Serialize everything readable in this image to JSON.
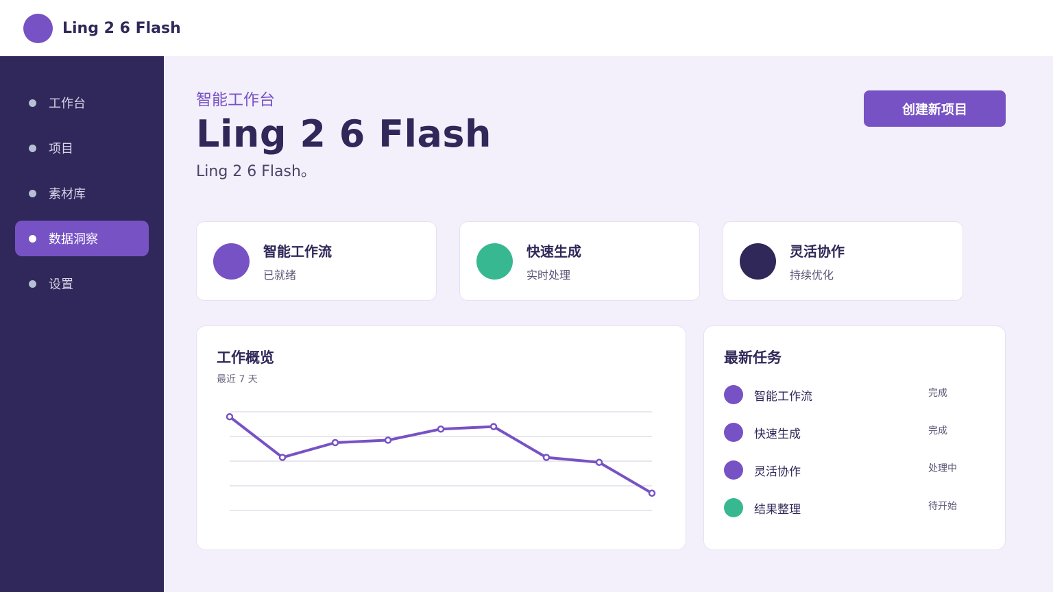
{
  "brand": {
    "name": "Ling 2 6 Flash",
    "accent": "#7752c4"
  },
  "sidebar": {
    "items": [
      {
        "label": "工作台",
        "active": false
      },
      {
        "label": "项目",
        "active": false
      },
      {
        "label": "素材库",
        "active": false
      },
      {
        "label": "数据洞察",
        "active": true
      },
      {
        "label": "设置",
        "active": false
      }
    ]
  },
  "header": {
    "eyebrow": "智能工作台",
    "title": "Ling 2 6 Flash",
    "subtitle": "Ling 2 6 Flash。",
    "create_button": "创建新项目"
  },
  "stats": [
    {
      "title": "智能工作流",
      "sub": "已就绪",
      "color": "#7752c4"
    },
    {
      "title": "快速生成",
      "sub": "实时处理",
      "color": "#37b891"
    },
    {
      "title": "灵活协作",
      "sub": "持续优化",
      "color": "#2f2858"
    }
  ],
  "overview": {
    "title": "工作概览",
    "subtitle": "最近 7 天"
  },
  "chart_data": {
    "type": "line",
    "title": "工作概览",
    "subtitle": "最近 7 天",
    "x": [
      1,
      2,
      3,
      4,
      5,
      6,
      7,
      8,
      9
    ],
    "series": [
      {
        "values": [
          96,
          63,
          75,
          77,
          86,
          88,
          63,
          59,
          34
        ],
        "color": "#7752c4"
      }
    ],
    "ylim": [
      20,
      100
    ],
    "grid": true,
    "xlabel": "",
    "ylabel": ""
  },
  "tasks": {
    "title": "最新任务",
    "items": [
      {
        "name": "智能工作流",
        "status": "完成",
        "color": "#7752c4"
      },
      {
        "name": "快速生成",
        "status": "完成",
        "color": "#7752c4"
      },
      {
        "name": "灵活协作",
        "status": "处理中",
        "color": "#7752c4"
      },
      {
        "name": "结果整理",
        "status": "待开始",
        "color": "#37b891"
      }
    ]
  }
}
